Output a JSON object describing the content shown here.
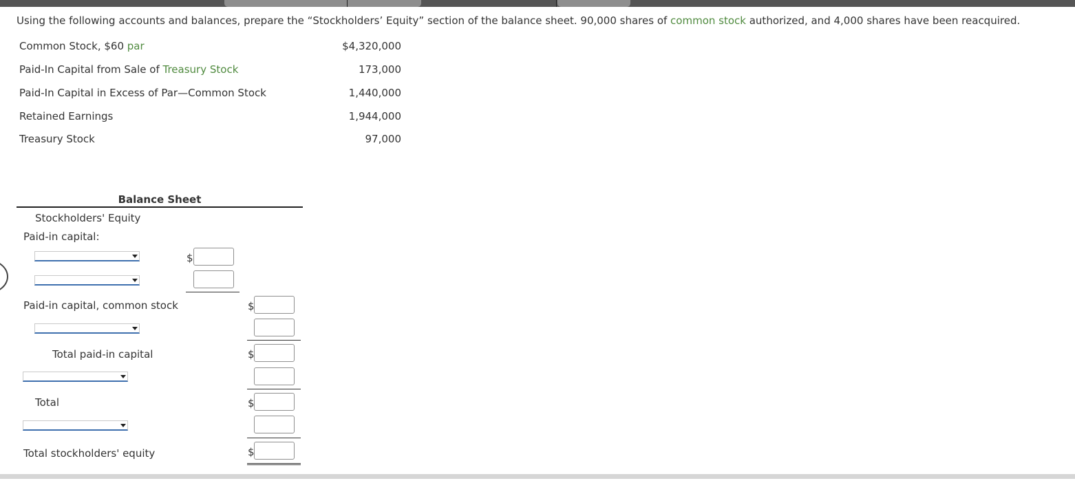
{
  "question": {
    "part1": "Using the following accounts and balances, prepare the “Stockholders’ Equity” section of the balance sheet. 90,000 shares of ",
    "link": "common stock",
    "part2": " authorized, and 4,000 shares have been reacquired."
  },
  "accounts": [
    {
      "label": "Common Stock, $60 ",
      "link": "par",
      "amount": "$4,320,000"
    },
    {
      "label": "Paid-In Capital from Sale of ",
      "link": "Treasury Stock",
      "amount": "173,000"
    },
    {
      "label": "Paid-In Capital in Excess of Par—Common Stock",
      "link": "",
      "amount": "1,440,000"
    },
    {
      "label": "Retained Earnings",
      "link": "",
      "amount": "1,944,000"
    },
    {
      "label": "Treasury Stock",
      "link": "",
      "amount": "97,000"
    }
  ],
  "balance_sheet": {
    "title": "Balance Sheet",
    "subtitle": "Stockholders' Equity",
    "paid_in_capital_label": "Paid-in capital:",
    "paid_in_common_label": "Paid-in capital, common stock",
    "total_paid_in_label": "Total paid-in capital",
    "total_label": "Total",
    "total_se_label": "Total stockholders' equity",
    "dollar_sign": "$"
  },
  "colors": {
    "link_green": "#4f8a3e",
    "dropdown_underline": "#3e6fae"
  }
}
